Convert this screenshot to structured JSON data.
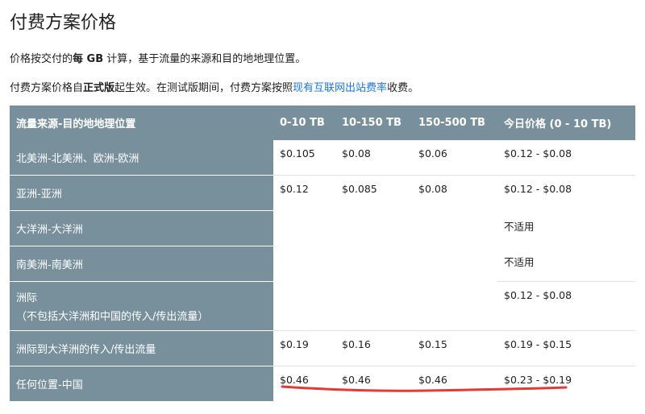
{
  "title": "付费方案价格",
  "para1": {
    "pre": "价格按交付的",
    "bold": "每 GB",
    "post": " 计算，基于流量的来源和目的地地理位置。"
  },
  "para2": {
    "pre": "付费方案价格自",
    "bold": "正式版",
    "mid": "起生效。在测试版期间，付费方案按照",
    "link": "现有互联网出站费率",
    "post": "收费。"
  },
  "table": {
    "headers": [
      "流量来源-目的地地理位置",
      "0-10 TB",
      "10-150 TB",
      "150-500 TB",
      "今日价格 (0 - 10 TB)"
    ],
    "rows": [
      {
        "region": "北美洲-北美洲、欧洲-欧洲",
        "c1": "$0.105",
        "c2": "$0.08",
        "c3": "$0.06",
        "today": "$0.12 - $0.08"
      },
      {
        "region": "亚洲-亚洲",
        "c1": "$0.12",
        "c2": "$0.085",
        "c3": "$0.08",
        "today": "$0.12 - $0.08"
      },
      {
        "region": "大洋洲-大洋洲",
        "today": "不适用"
      },
      {
        "region": "南美洲-南美洲",
        "today": "不适用"
      },
      {
        "region": "洲际",
        "region_note": "（不包括大洋洲和中国的传入/传出流量）",
        "today": "$0.12 - $0.08"
      },
      {
        "region": "洲际到大洋洲的传入/传出流量",
        "c1": "$0.19",
        "c2": "$0.16",
        "c3": "$0.15",
        "today": "$0.19 - $0.15"
      },
      {
        "region": "任何位置-中国",
        "c1": "$0.46",
        "c2": "$0.46",
        "c3": "$0.46",
        "today": "$0.23 - $0.19"
      }
    ]
  },
  "annotation_color": "#e53935"
}
